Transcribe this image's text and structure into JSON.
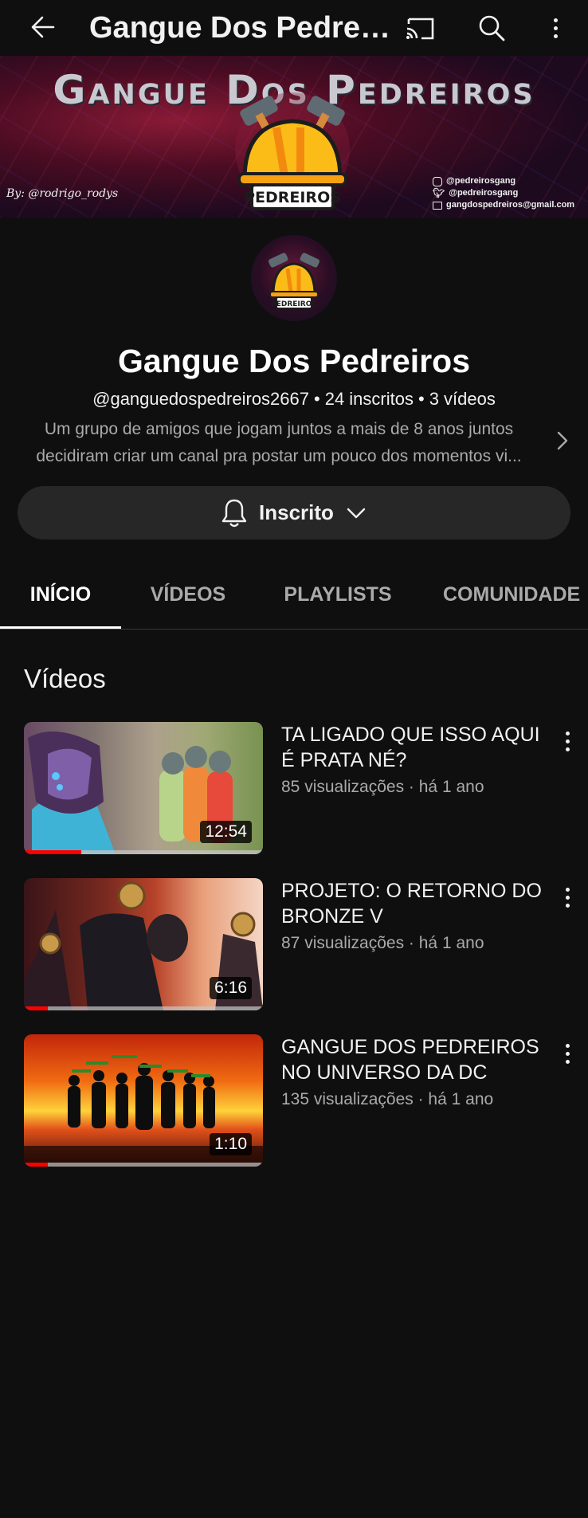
{
  "header": {
    "title": "Gangue Dos Pedreiros...",
    "back_icon": "arrow-left-icon",
    "cast_icon": "cast-icon",
    "search_icon": "search-icon",
    "more_icon": "more-vertical-icon"
  },
  "banner": {
    "title": "Gangue Dos Pedreiros",
    "logo_text": "PEDREIROS",
    "by_text": "By: @rodrigo_rodys",
    "contacts": [
      {
        "icon": "instagram-icon",
        "text": "@pedreirosgang"
      },
      {
        "icon": "twitter-icon",
        "text": "@pedreirosgang"
      },
      {
        "icon": "mail-icon",
        "text": "gangdospedreiros@gmail.com"
      }
    ]
  },
  "channel": {
    "avatar_text": "PEDREIROS",
    "name": "Gangue Dos Pedreiros",
    "handle": "@ganguedospedreiros2667",
    "subscribers": "24 inscritos",
    "video_count": "3 vídeos",
    "separator": "•",
    "description_line1": "Um grupo de amigos que jogam juntos a mais de 8 anos juntos",
    "description_line2": "decidiram criar um canal pra postar um pouco dos momentos vi..."
  },
  "subscribe": {
    "label": "Inscrito",
    "bell_icon": "bell-icon",
    "chevron_icon": "chevron-down-icon"
  },
  "tabs": [
    {
      "label": "INÍCIO",
      "active": true
    },
    {
      "label": "VÍDEOS",
      "active": false
    },
    {
      "label": "PLAYLISTS",
      "active": false
    },
    {
      "label": "COMUNIDADE",
      "active": false
    }
  ],
  "section": {
    "title": "Vídeos"
  },
  "videos": [
    {
      "title": "TA LIGADO QUE ISSO AQUI É PRATA NÉ?",
      "meta": "85 visualizações · há 1 ano",
      "duration": "12:54",
      "watched_fraction": 0.24
    },
    {
      "title": "PROJETO: O RETORNO DO BRONZE V",
      "meta": "87 visualizações · há 1 ano",
      "duration": "6:16",
      "watched_fraction": 0.1
    },
    {
      "title": "GANGUE DOS PEDREIROS NO UNIVERSO DA DC",
      "meta": "135 visualizações · há 1 ano",
      "duration": "1:10",
      "watched_fraction": 0.1
    }
  ],
  "colors": {
    "background": "#0f0f0f",
    "accent_red": "#ff0000",
    "button_bg": "#272727",
    "secondary_text": "#aaaaaa"
  }
}
